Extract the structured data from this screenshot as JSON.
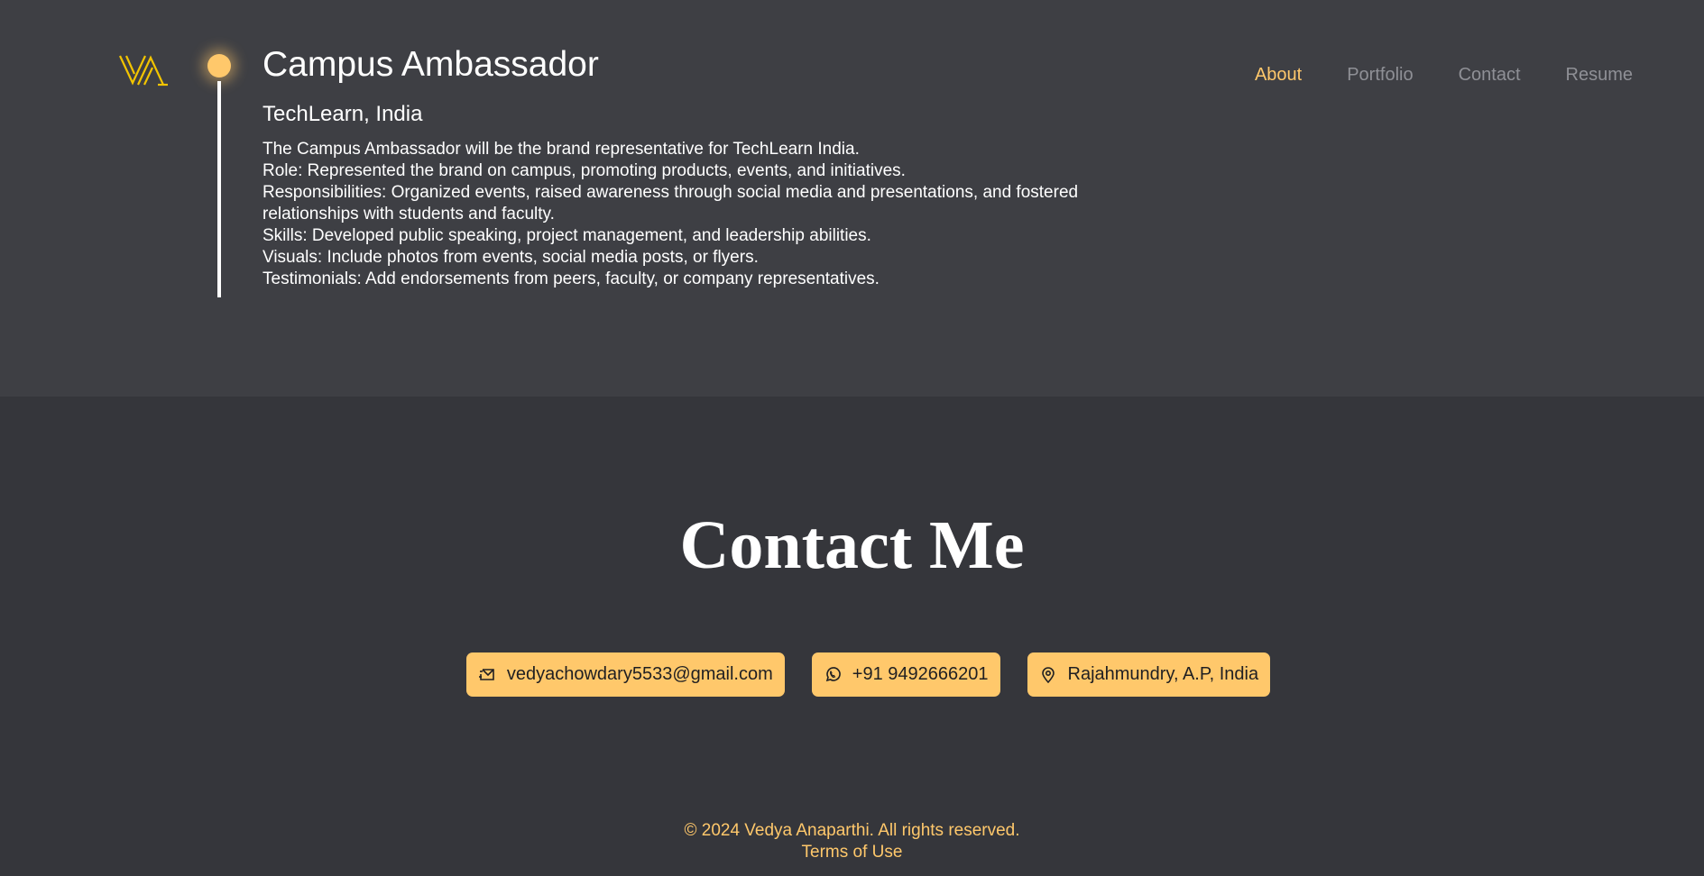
{
  "brand": {
    "logo_icon": "va-monogram-logo",
    "accent_color": "#ffc86b"
  },
  "nav": {
    "items": [
      {
        "label": "About",
        "active": true
      },
      {
        "label": "Portfolio",
        "active": false
      },
      {
        "label": "Contact",
        "active": false
      },
      {
        "label": "Resume",
        "active": false
      }
    ]
  },
  "experience": {
    "title": "Campus Ambassador",
    "company": "TechLearn, India",
    "lines": [
      "The Campus Ambassador will be the brand representative for TechLearn India.",
      "Role: Represented the brand on campus, promoting products, events, and initiatives.",
      "Responsibilities: Organized events, raised awareness through social media and presentations, and fostered relationships with students and faculty.",
      "Skills: Developed public speaking, project management, and leadership abilities.",
      "Visuals: Include photos from events, social media posts, or flyers.",
      "Testimonials: Add endorsements from peers, faculty, or company representatives."
    ]
  },
  "contact": {
    "heading": "Contact Me",
    "items": [
      {
        "icon": "mail-icon",
        "label": "vedyachowdary5533@gmail.com"
      },
      {
        "icon": "whatsapp-icon",
        "label": "+91 9492666201"
      },
      {
        "icon": "location-pin-icon",
        "label": "Rajahmundry, A.P, India"
      }
    ]
  },
  "footer": {
    "copyright": "© 2024 Vedya Anaparthi. All rights reserved.",
    "terms": "Terms of Use"
  }
}
